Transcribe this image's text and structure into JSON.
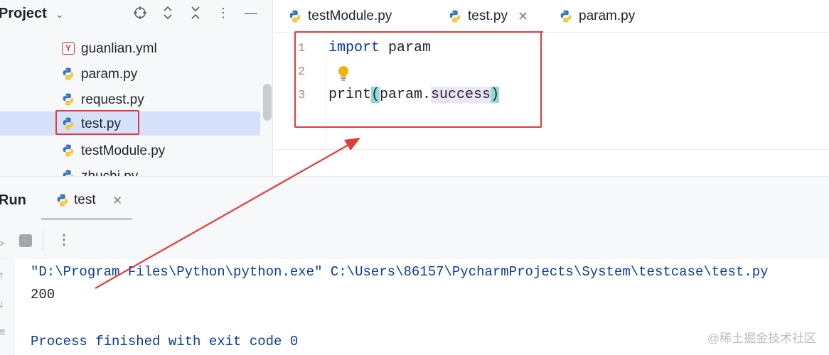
{
  "project": {
    "title": "Project",
    "files": [
      {
        "name": "guanlian.yml",
        "icon": "yml-file-icon",
        "selected": false
      },
      {
        "name": "param.py",
        "icon": "python-file-icon",
        "selected": false
      },
      {
        "name": "request.py",
        "icon": "python-file-icon",
        "selected": false
      },
      {
        "name": "test.py",
        "icon": "python-file-icon",
        "selected": true
      },
      {
        "name": "testModule.py",
        "icon": "python-file-icon",
        "selected": false
      },
      {
        "name": "zhuchi.py",
        "icon": "python-file-icon",
        "selected": false
      }
    ]
  },
  "editor": {
    "tabs": [
      {
        "label": "testModule.py",
        "active": false
      },
      {
        "label": "test.py",
        "active": true
      },
      {
        "label": "param.py",
        "active": false
      }
    ],
    "line_numbers": [
      "1",
      "2",
      "3"
    ],
    "code": {
      "line1_keyword": "import",
      "line1_rest": " param",
      "line3_func": "print",
      "line3_open": "(",
      "line3_module": "param.",
      "line3_member": "success",
      "line3_close": ")"
    }
  },
  "run": {
    "title": "Run",
    "tab_label": "test",
    "console": {
      "command": "\"D:\\Program Files\\Python\\python.exe\" C:\\Users\\86157\\PycharmProjects\\System\\testcase\\test.py",
      "output": "200",
      "exit": "Process finished with exit code 0"
    }
  },
  "watermark": "@稀土掘金技术社区",
  "colors": {
    "annotation": "#e33b3b",
    "selection": "#d5e1fb",
    "keyword": "#0033b3",
    "console_text": "#0a3a9c"
  }
}
